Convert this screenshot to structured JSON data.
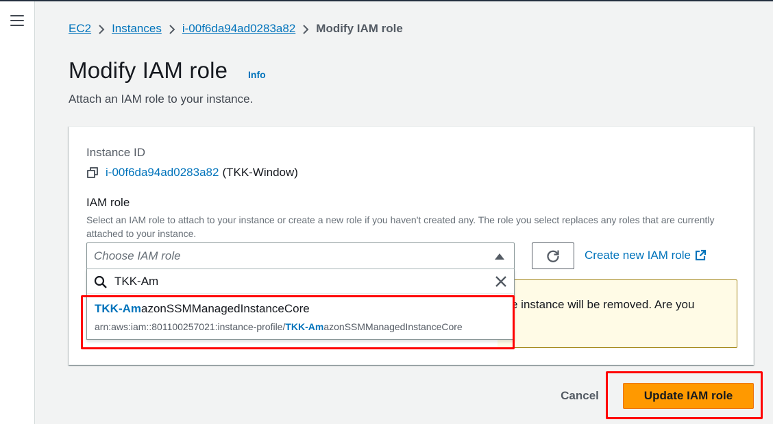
{
  "breadcrumb": {
    "items": [
      "EC2",
      "Instances",
      "i-00f6da94ad0283a82"
    ],
    "current": "Modify IAM role"
  },
  "page": {
    "title": "Modify IAM role",
    "info_label": "Info",
    "description": "Attach an IAM role to your instance."
  },
  "instance": {
    "label": "Instance ID",
    "id": "i-00f6da94ad0283a82",
    "name": "(TKK-Window)"
  },
  "iam_role": {
    "label": "IAM role",
    "description": "Select an IAM role to attach to your instance or create a new role if you haven't created any. The role you select replaces any roles that are currently attached to your instance.",
    "placeholder": "Choose IAM role",
    "create_link": "Create new IAM role"
  },
  "search": {
    "value": "TKK-Am"
  },
  "option": {
    "title_match": "TKK-Am",
    "title_rest": "azonSSMManagedInstanceCore",
    "sub_prefix": "arn:aws:iam::801100257021:instance-profile/",
    "sub_match": "TKK-Am",
    "sub_rest": "azonSSMManagedInstanceCore"
  },
  "warning": {
    "text_visible": "e instance will be removed. Are you"
  },
  "footer": {
    "cancel_label": "Cancel",
    "update_label": "Update IAM role"
  },
  "colors": {
    "link": "#0073bb",
    "primary_button": "#ff9900",
    "annotation": "#ff0000",
    "warning_bg": "#fffbe6"
  },
  "icons": [
    "menu-icon",
    "chevron-right-icon",
    "copy-icon",
    "caret-up-icon",
    "refresh-icon",
    "external-link-icon",
    "search-icon",
    "close-icon"
  ]
}
